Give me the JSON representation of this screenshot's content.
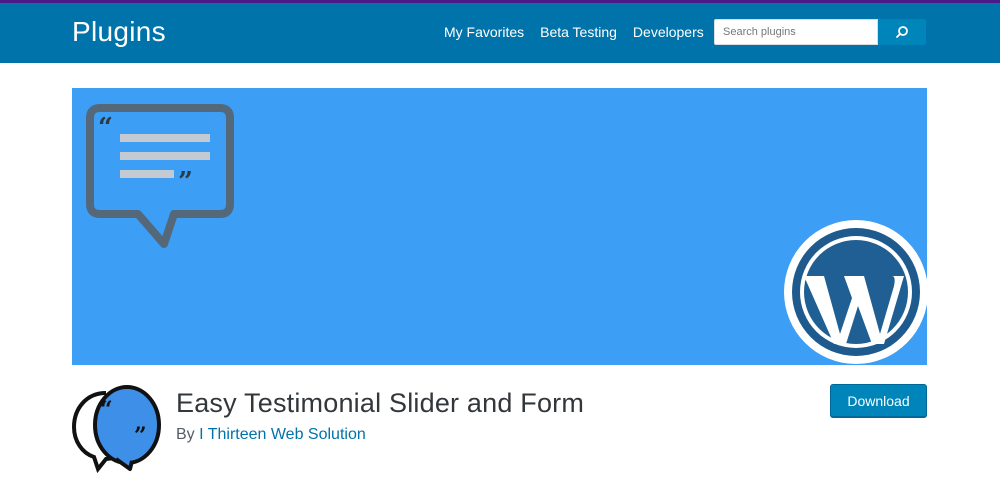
{
  "header": {
    "brand": "Plugins",
    "nav": [
      "My Favorites",
      "Beta Testing",
      "Developers"
    ],
    "search": {
      "placeholder": "Search plugins"
    }
  },
  "plugin": {
    "title": "Easy Testimonial Slider and Form",
    "by_label": "By",
    "author": "I Thirteen Web Solution",
    "download_label": "Download"
  },
  "colors": {
    "header_bg": "#0073aa",
    "banner_bg": "#3d9ef5",
    "button_bg": "#0085ba"
  }
}
